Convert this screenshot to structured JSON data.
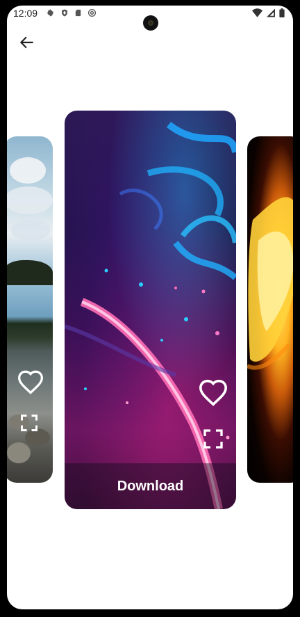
{
  "status_bar": {
    "time": "12:09",
    "left_icons": [
      "gear-icon",
      "shield-icon",
      "sd-card-icon",
      "at-sign-icon"
    ],
    "right_icons": [
      "wifi-icon",
      "cell-signal-icon",
      "battery-icon"
    ]
  },
  "nav": {
    "back_icon": "arrow-left-icon"
  },
  "carousel": {
    "cards": [
      {
        "name": "lake-wallpaper",
        "favorite_icon": "heart-outline-icon",
        "fullscreen_icon": "fullscreen-icon"
      },
      {
        "name": "neon-wallpaper",
        "favorite_icon": "heart-outline-icon",
        "fullscreen_icon": "fullscreen-icon",
        "download_label": "Download"
      },
      {
        "name": "fire-wallpaper"
      }
    ]
  },
  "colors": {
    "screen_bg": "#ffffff",
    "frame": "#000000",
    "icon_white": "#ffffff"
  }
}
